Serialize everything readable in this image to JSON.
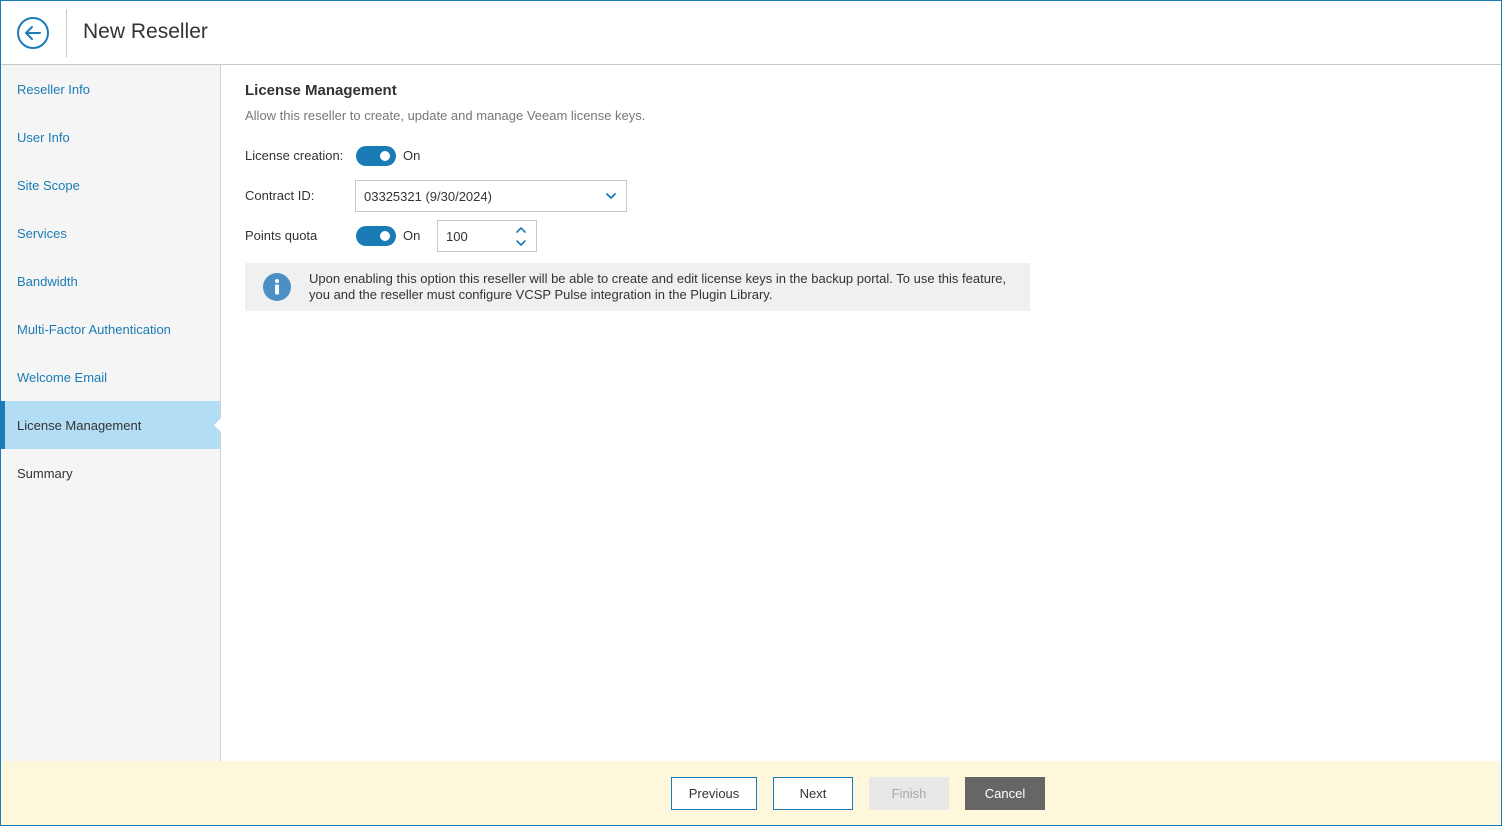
{
  "header": {
    "title": "New Reseller",
    "back_icon": "arrow-left-icon"
  },
  "sidebar": {
    "items": [
      {
        "label": "Reseller Info",
        "state": "link"
      },
      {
        "label": "User Info",
        "state": "link"
      },
      {
        "label": "Site Scope",
        "state": "link"
      },
      {
        "label": "Services",
        "state": "link"
      },
      {
        "label": "Bandwidth",
        "state": "link"
      },
      {
        "label": "Multi-Factor Authentication",
        "state": "link"
      },
      {
        "label": "Welcome Email",
        "state": "link"
      },
      {
        "label": "License Management",
        "state": "active"
      },
      {
        "label": "Summary",
        "state": "plain"
      }
    ]
  },
  "main": {
    "title": "License Management",
    "description": "Allow this reseller to create, update and manage Veeam license keys.",
    "license_creation": {
      "label": "License creation:",
      "toggle_state": "On"
    },
    "contract_id": {
      "label": "Contract ID:",
      "value": "03325321 (9/30/2024)"
    },
    "points_quota": {
      "label": "Points quota",
      "toggle_state": "On",
      "value": "100"
    },
    "info": {
      "icon": "info-icon",
      "text": "Upon enabling this option this reseller will be able to create and edit license keys in the backup portal. To use this feature, you and the reseller must configure VCSP Pulse integration in the Plugin Library."
    }
  },
  "footer": {
    "previous_label": "Previous",
    "next_label": "Next",
    "finish_label": "Finish",
    "cancel_label": "Cancel"
  },
  "colors": {
    "accent": "#1a7bb7",
    "active_nav": "#b3dcf5",
    "footer_bg": "#fdf8dc",
    "info_bg": "#f0f0f0",
    "info_icon": "#4a90c4"
  }
}
